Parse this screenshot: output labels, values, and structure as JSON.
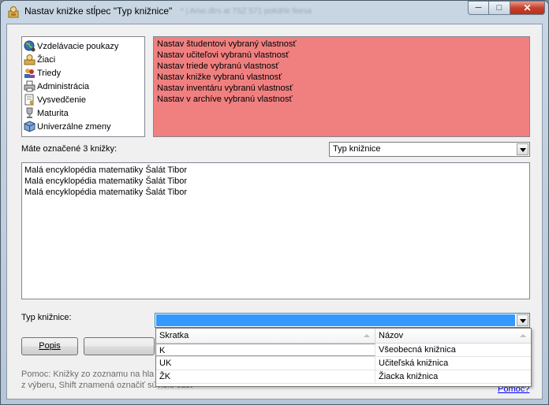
{
  "window": {
    "title": "Nastav knižke stĺpec \"Typ knižnice\"",
    "title_blurred_suffix": "* | Ame.dtrs at 7SZ 571 pokdrle feesa",
    "minimize_glyph": "─",
    "maximize_glyph": "□",
    "close_glyph": "✕"
  },
  "categories": [
    {
      "label": "Vzdelávacie poukazy",
      "icon": "globe-icon"
    },
    {
      "label": "Žiaci",
      "icon": "student-icon"
    },
    {
      "label": "Triedy",
      "icon": "people-icon"
    },
    {
      "label": "Administrácia",
      "icon": "printer-icon"
    },
    {
      "label": "Vysvedčenie",
      "icon": "certificate-icon"
    },
    {
      "label": "Maturita",
      "icon": "trophy-icon"
    },
    {
      "label": "Univerzálne zmeny",
      "icon": "cube-icon"
    }
  ],
  "actions": [
    "Nastav študentovi vybraný vlastnosť",
    "Nastav učiteľovi vybranú vlastnosť",
    "Nastav triede vybranú vlastnosť",
    "Nastav knižke vybranú vlastnosť",
    "Nastav inventáru vybranú vlastnosť",
    "Nastav v archíve vybranú vlastnosť"
  ],
  "selection_label": "Máte označené 3 knižky:",
  "column_combo": {
    "value": "Typ knižnice"
  },
  "books": [
    "Malá encyklopédia matematiky Šalát Tibor",
    "Malá encyklopédia matematiky Šalát Tibor",
    "Malá encyklopédia matematiky Šalát Tibor"
  ],
  "type_label": "Typ knižnice:",
  "type_combo": {
    "value": ""
  },
  "dropdown": {
    "headers": {
      "code": "Skratka",
      "name": "Názov"
    },
    "rows": [
      {
        "code": "K",
        "name": "Všeobecná knižnica"
      },
      {
        "code": "UK",
        "name": "Učiteľská knižnica"
      },
      {
        "code": "ŽK",
        "name": "Žiacka knižnica"
      }
    ]
  },
  "buttons": {
    "popis": "Popis",
    "second": ""
  },
  "help": {
    "line1": "Pomoc: Knižky zo zoznamu na hla",
    "line2": "z výberu, Shift znamená označiť súvislú časť",
    "link": "Pomoc?"
  },
  "colors": {
    "actions_panel": "#f08080",
    "selection_highlight": "#3399ff",
    "link": "#0000ff"
  }
}
